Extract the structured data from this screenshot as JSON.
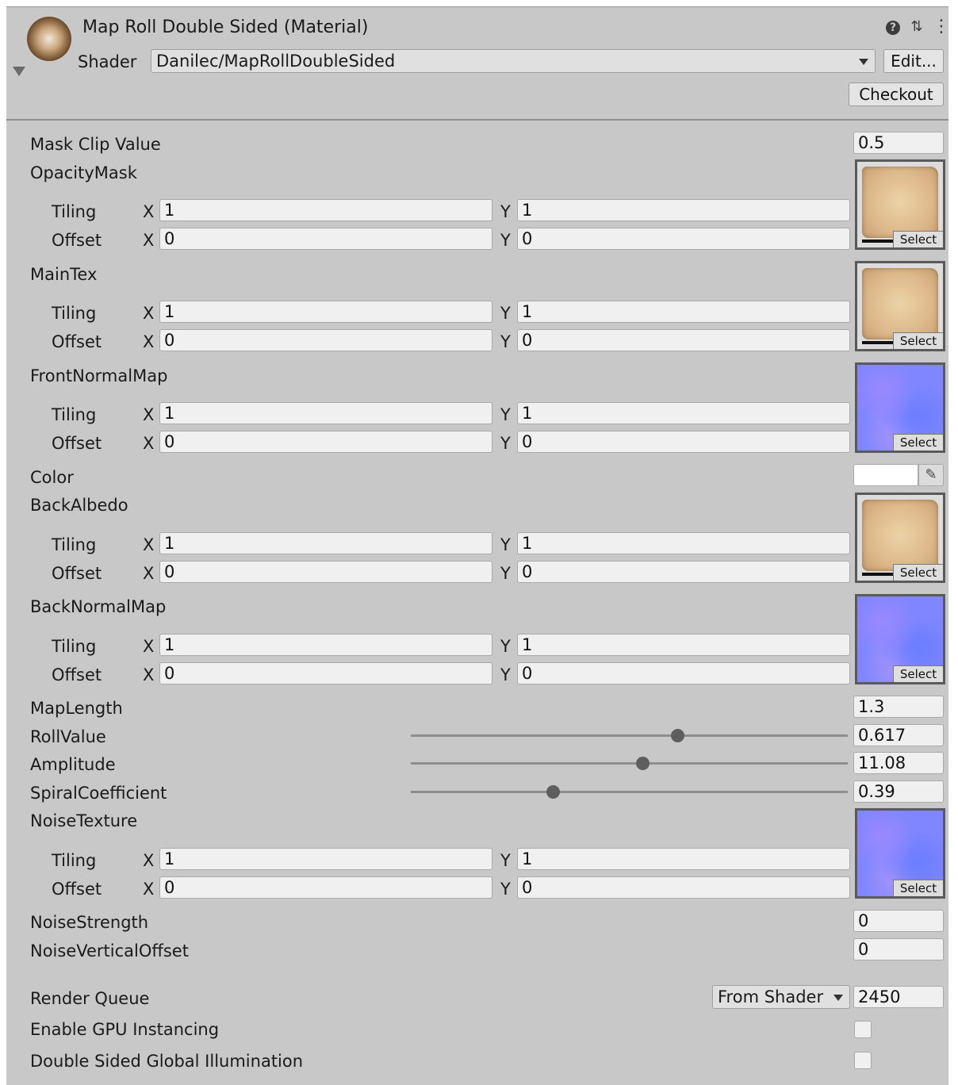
{
  "header": {
    "title": "Map Roll Double Sided (Material)",
    "shader_label": "Shader",
    "shader_value": "Danilec/MapRollDoubleSided",
    "edit_label": "Edit...",
    "checkout_label": "Checkout",
    "icons": [
      "help-icon",
      "preset-icon",
      "more-icon"
    ]
  },
  "properties": {
    "mask_clip": {
      "label": "Mask Clip Value",
      "value": "0.5"
    },
    "opacity_mask": {
      "label": "OpacityMask",
      "tiling_label": "Tiling",
      "offset_label": "Offset",
      "x_label": "X",
      "y_label": "Y",
      "tiling_x": "1",
      "tiling_y": "1",
      "offset_x": "0",
      "offset_y": "0",
      "select_label": "Select"
    },
    "main_tex": {
      "label": "MainTex",
      "tiling_label": "Tiling",
      "offset_label": "Offset",
      "x_label": "X",
      "y_label": "Y",
      "tiling_x": "1",
      "tiling_y": "1",
      "offset_x": "0",
      "offset_y": "0",
      "select_label": "Select"
    },
    "front_normal": {
      "label": "FrontNormalMap",
      "tiling_label": "Tiling",
      "offset_label": "Offset",
      "x_label": "X",
      "y_label": "Y",
      "tiling_x": "1",
      "tiling_y": "1",
      "offset_x": "0",
      "offset_y": "0",
      "select_label": "Select"
    },
    "color": {
      "label": "Color",
      "value": "#ffffff"
    },
    "back_albedo": {
      "label": "BackAlbedo",
      "tiling_label": "Tiling",
      "offset_label": "Offset",
      "x_label": "X",
      "y_label": "Y",
      "tiling_x": "1",
      "tiling_y": "1",
      "offset_x": "0",
      "offset_y": "0",
      "select_label": "Select"
    },
    "back_normal": {
      "label": "BackNormalMap",
      "tiling_label": "Tiling",
      "offset_label": "Offset",
      "x_label": "X",
      "y_label": "Y",
      "tiling_x": "1",
      "tiling_y": "1",
      "offset_x": "0",
      "offset_y": "0",
      "select_label": "Select"
    },
    "map_length": {
      "label": "MapLength",
      "value": "1.3"
    },
    "roll_value": {
      "label": "RollValue",
      "value": "0.617",
      "slider_fraction": 0.61
    },
    "amplitude": {
      "label": "Amplitude",
      "value": "11.08",
      "slider_fraction": 0.53
    },
    "spiral": {
      "label": "SpiralCoefficient",
      "value": "0.39",
      "slider_fraction": 0.325
    },
    "noise_texture": {
      "label": "NoiseTexture",
      "tiling_label": "Tiling",
      "offset_label": "Offset",
      "x_label": "X",
      "y_label": "Y",
      "tiling_x": "1",
      "tiling_y": "1",
      "offset_x": "0",
      "offset_y": "0",
      "select_label": "Select"
    },
    "noise_strength": {
      "label": "NoiseStrength",
      "value": "0"
    },
    "noise_vertical": {
      "label": "NoiseVerticalOffset",
      "value": "0"
    }
  },
  "footer": {
    "render_queue_label": "Render Queue",
    "render_queue_mode": "From Shader",
    "render_queue_value": "2450",
    "gpu_instancing_label": "Enable GPU Instancing",
    "gpu_instancing_checked": false,
    "double_sided_gi_label": "Double Sided Global Illumination",
    "double_sided_gi_checked": false
  },
  "colors": {
    "panel_bg": "#c8c8c8",
    "field_bg": "#f0f0f0",
    "normal_map_tint": "#7f86ff",
    "parchment_tint": "#dcb88a"
  }
}
